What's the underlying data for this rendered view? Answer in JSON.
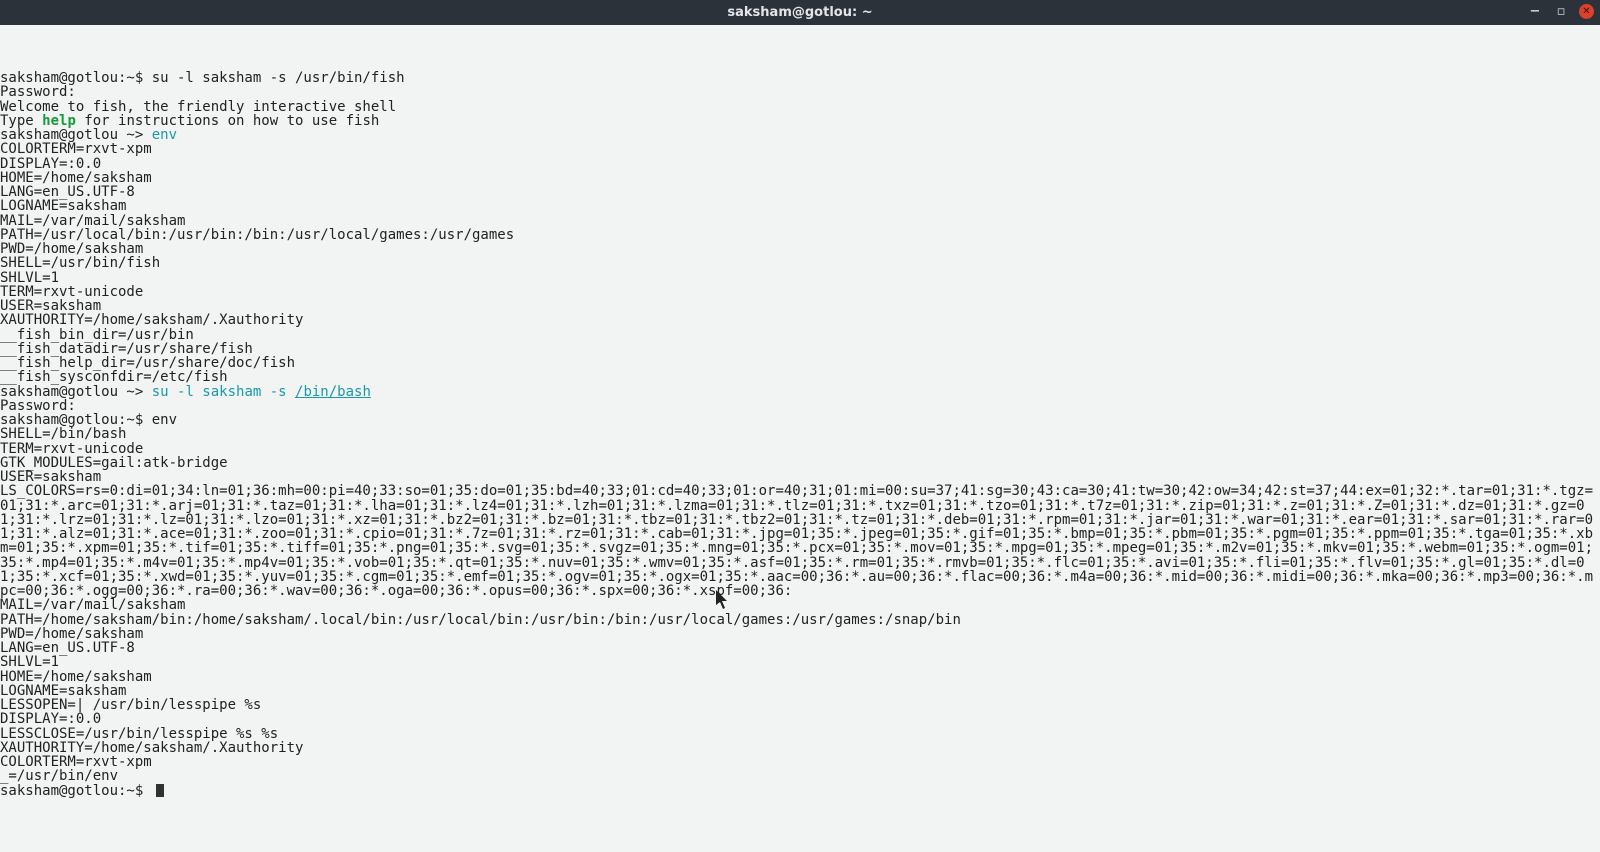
{
  "window": {
    "title": "saksham@gotlou: ~"
  },
  "prompts": {
    "bash": "saksham@gotlou:~$",
    "fish": "saksham@gotlou ~>"
  },
  "commands": {
    "su_fish": " su -l saksham -s /usr/bin/fish",
    "env": " env",
    "su_bash_plain": " su -l saksham -s ",
    "su_bash_path": "/bin/bash",
    "env2": " env"
  },
  "literals": {
    "password": "Password:",
    "welcome": "Welcome to fish, the friendly interactive shell",
    "type_pre": "Type ",
    "help": "help",
    "type_post": " for instructions on how to use fish"
  },
  "env_fish": [
    "COLORTERM=rxvt-xpm",
    "DISPLAY=:0.0",
    "HOME=/home/saksham",
    "LANG=en_US.UTF-8",
    "LOGNAME=saksham",
    "MAIL=/var/mail/saksham",
    "PATH=/usr/local/bin:/usr/bin:/bin:/usr/local/games:/usr/games",
    "PWD=/home/saksham",
    "SHELL=/usr/bin/fish",
    "SHLVL=1",
    "TERM=rxvt-unicode",
    "USER=saksham",
    "XAUTHORITY=/home/saksham/.Xauthority",
    "__fish_bin_dir=/usr/bin",
    "__fish_datadir=/usr/share/fish",
    "__fish_help_dir=/usr/share/doc/fish",
    "__fish_sysconfdir=/etc/fish"
  ],
  "env_bash_head": [
    "SHELL=/bin/bash",
    "TERM=rxvt-unicode",
    "GTK_MODULES=gail:atk-bridge",
    "USER=saksham"
  ],
  "ls_colors": "LS_COLORS=rs=0:di=01;34:ln=01;36:mh=00:pi=40;33:so=01;35:do=01;35:bd=40;33;01:cd=40;33;01:or=40;31;01:mi=00:su=37;41:sg=30;43:ca=30;41:tw=30;42:ow=34;42:st=37;44:ex=01;32:*.tar=01;31:*.tgz=01;31:*.arc=01;31:*.arj=01;31:*.taz=01;31:*.lha=01;31:*.lz4=01;31:*.lzh=01;31:*.lzma=01;31:*.tlz=01;31:*.txz=01;31:*.tzo=01;31:*.t7z=01;31:*.zip=01;31:*.z=01;31:*.Z=01;31:*.dz=01;31:*.gz=01;31:*.lrz=01;31:*.lz=01;31:*.lzo=01;31:*.xz=01;31:*.bz2=01;31:*.bz=01;31:*.tbz=01;31:*.tbz2=01;31:*.tz=01;31:*.deb=01;31:*.rpm=01;31:*.jar=01;31:*.war=01;31:*.ear=01;31:*.sar=01;31:*.rar=01;31:*.alz=01;31:*.ace=01;31:*.zoo=01;31:*.cpio=01;31:*.7z=01;31:*.rz=01;31:*.cab=01;31:*.jpg=01;35:*.jpeg=01;35:*.gif=01;35:*.bmp=01;35:*.pbm=01;35:*.pgm=01;35:*.ppm=01;35:*.tga=01;35:*.xbm=01;35:*.xpm=01;35:*.tif=01;35:*.tiff=01;35:*.png=01;35:*.svg=01;35:*.svgz=01;35:*.mng=01;35:*.pcx=01;35:*.mov=01;35:*.mpg=01;35:*.mpeg=01;35:*.m2v=01;35:*.mkv=01;35:*.webm=01;35:*.ogm=01;35:*.mp4=01;35:*.m4v=01;35:*.mp4v=01;35:*.vob=01;35:*.qt=01;35:*.nuv=01;35:*.wmv=01;35:*.asf=01;35:*.rm=01;35:*.rmvb=01;35:*.flc=01;35:*.avi=01;35:*.fli=01;35:*.flv=01;35:*.gl=01;35:*.dl=01;35:*.xcf=01;35:*.xwd=01;35:*.yuv=01;35:*.cgm=01;35:*.emf=01;35:*.ogv=01;35:*.ogx=01;35:*.aac=00;36:*.au=00;36:*.flac=00;36:*.m4a=00;36:*.mid=00;36:*.midi=00;36:*.mka=00;36:*.mp3=00;36:*.mpc=00;36:*.ogg=00;36:*.ra=00;36:*.wav=00;36:*.oga=00;36:*.opus=00;36:*.spx=00;36:*.xspf=00;36:",
  "env_bash_tail": [
    "MAIL=/var/mail/saksham",
    "PATH=/home/saksham/bin:/home/saksham/.local/bin:/usr/local/bin:/usr/bin:/bin:/usr/local/games:/usr/games:/snap/bin",
    "PWD=/home/saksham",
    "LANG=en_US.UTF-8",
    "SHLVL=1",
    "HOME=/home/saksham",
    "LOGNAME=saksham",
    "LESSOPEN=| /usr/bin/lesspipe %s",
    "DISPLAY=:0.0",
    "LESSCLOSE=/usr/bin/lesspipe %s %s",
    "XAUTHORITY=/home/saksham/.Xauthority",
    "COLORTERM=rxvt-xpm",
    "_=/usr/bin/env"
  ]
}
